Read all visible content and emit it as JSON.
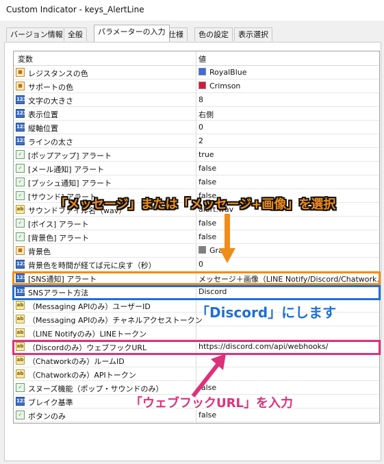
{
  "window": {
    "title": "Custom Indicator - keys_AlertLine"
  },
  "tabs": [
    {
      "label": "バージョン情報"
    },
    {
      "label": "全般"
    },
    {
      "label": "パラメーターの入力"
    },
    {
      "label": "仕様"
    },
    {
      "label": "色の設定"
    },
    {
      "label": "表示選択"
    }
  ],
  "grid": {
    "col_variable": "変数",
    "col_value": "値",
    "rows": [
      {
        "name": "レジスタンスの色",
        "value": "RoyalBlue",
        "type": "color",
        "swatch": "#4169E1"
      },
      {
        "name": "サポートの色",
        "value": "Crimson",
        "type": "color",
        "swatch": "#DC143C"
      },
      {
        "name": "文字の大きさ",
        "value": "8",
        "type": "number"
      },
      {
        "name": "表示位置",
        "value": "右側",
        "type": "number"
      },
      {
        "name": "縦軸位置",
        "value": "0",
        "type": "number"
      },
      {
        "name": "ラインの太さ",
        "value": "2",
        "type": "number"
      },
      {
        "name": "[ポップアップ] アラート",
        "value": "true",
        "type": "bool"
      },
      {
        "name": "[メール通知] アラート",
        "value": "false",
        "type": "bool"
      },
      {
        "name": "[プッシュ通知] アラート",
        "value": "false",
        "type": "bool"
      },
      {
        "name": "[サウンド] アラート",
        "value": "false",
        "type": "bool"
      },
      {
        "name": "サウンドファイル名（wav）",
        "value": "alert.wav",
        "type": "string"
      },
      {
        "name": "[ボイス] アラート",
        "value": "false",
        "type": "bool"
      },
      {
        "name": "[背景色] アラート",
        "value": "false",
        "type": "bool"
      },
      {
        "name": "背景色",
        "value": "Gray",
        "type": "color",
        "swatch": "#808080"
      },
      {
        "name": "背景色を時間が経てば元に戻す（秒）",
        "value": "0",
        "type": "number"
      },
      {
        "name": "[SNS通知] アラート",
        "value": "メッセージ＋画像（LINE Notify/Discord/Chatwork...",
        "type": "number"
      },
      {
        "name": "SNSアラート方法",
        "value": "Discord",
        "type": "number"
      },
      {
        "name": "（Messaging APIのみ）ユーザーID",
        "value": "",
        "type": "string"
      },
      {
        "name": "（Messaging APIのみ）チャネルアクセストークン",
        "value": "",
        "type": "string"
      },
      {
        "name": "（LINE Notifyのみ）LINEトークン",
        "value": "",
        "type": "string"
      },
      {
        "name": "（Discordのみ）ウェブフックURL",
        "value": "https://discord.com/api/webhooks/",
        "type": "string"
      },
      {
        "name": "（Chatworkのみ）ルームID",
        "value": "",
        "type": "string"
      },
      {
        "name": "（Chatworkのみ）APIトークン",
        "value": "",
        "type": "string"
      },
      {
        "name": "スヌーズ機能（ポップ・サウンドのみ）",
        "value": "false",
        "type": "bool"
      },
      {
        "name": "ブレイク基準",
        "value": "",
        "type": "number"
      },
      {
        "name": "ボタンのみ",
        "value": "false",
        "type": "bool"
      }
    ]
  },
  "annotations": {
    "callout_select": "「メッセージ」または「メッセージ+画像」を選択",
    "callout_discord": "「Discord」にします",
    "callout_webhook": "「ウェブフックURL」を入力"
  },
  "colors": {
    "orange": "#F08C1A",
    "blue": "#1E6FD9",
    "pink": "#E0307A"
  },
  "icons": {
    "number": "123",
    "bool": "check-icon",
    "string": "ab",
    "color": "palette-icon"
  }
}
